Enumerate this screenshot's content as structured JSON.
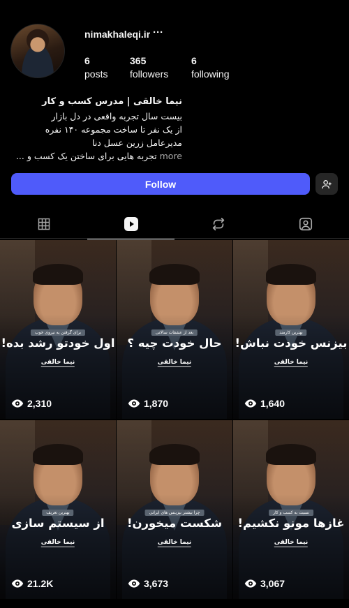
{
  "profile": {
    "username": "nimakhaleqi.ir",
    "more_icon": "···",
    "stats": [
      {
        "value": "6",
        "label": "posts"
      },
      {
        "value": "365",
        "label": "followers"
      },
      {
        "value": "6",
        "label": "following"
      }
    ],
    "bio": {
      "name": "نیما خالقی | مدرس کسب و کار",
      "lines": [
        "بیست سال تجربه واقعی در دل بازار",
        "از یک نفر تا ساخت مجموعه ۱۴۰ نفره",
        "مدیرعامل زرین عسل دنا"
      ],
      "last_line": "تجربه هایی برای ساختن یک کسب و ...",
      "more_label": "more"
    },
    "follow_label": "Follow"
  },
  "tabs": [
    {
      "name": "grid-icon"
    },
    {
      "name": "reels-icon",
      "active": true
    },
    {
      "name": "reposts-icon"
    },
    {
      "name": "tagged-icon"
    }
  ],
  "reels": [
    {
      "subtitle": "برای گرفتن یه نیروی خوب",
      "title": "اول خودتو رشد بده!",
      "signature": "نیما خالقی",
      "views": "2,310"
    },
    {
      "subtitle": "بعد از عشقات سالانی",
      "title": "حال خودت چیه ؟",
      "signature": "نیما خالقی",
      "views": "1,870"
    },
    {
      "subtitle": "بهترین کارمند",
      "title": "بیزنس خودت نباش!",
      "signature": "نیما خالقی",
      "views": "1,640"
    },
    {
      "subtitle": "بهترین تعریف",
      "title": "از سیستم سازی",
      "signature": "نیما خالقی",
      "views": "21.2K"
    },
    {
      "subtitle": "چرا بیشتر بیزینس های ایرانی",
      "title": "شکست میخورن!",
      "signature": "نیما خالقی",
      "views": "3,673"
    },
    {
      "subtitle": "نسبت به کسب و کار",
      "title": "غازها مونو نکشیم!",
      "signature": "نیما خالقی",
      "views": "3,067"
    }
  ],
  "colors": {
    "follow_button": "#4f5bfa",
    "background": "#000000"
  }
}
